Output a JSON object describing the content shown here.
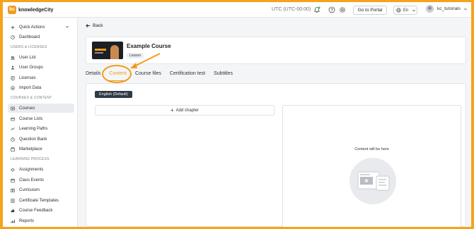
{
  "brand": {
    "name": "knowledgeCity",
    "mark": "kc",
    "color": "#f39a1b"
  },
  "topbar": {
    "timezone": "UTC (UTC-00:00)",
    "portal_button": "Go to Portal",
    "language": "En",
    "username": "kc_tutorials",
    "icons": [
      "bell-icon",
      "help-icon",
      "gear-icon",
      "globe-icon",
      "chevron-down-icon"
    ]
  },
  "sidebar": {
    "quick_actions": "Quick Actions",
    "dashboard": "Dashboard",
    "sections": [
      {
        "title": "USERS & LICENSES",
        "items": [
          "User List",
          "User Groups",
          "Licenses",
          "Import Data"
        ]
      },
      {
        "title": "COURSES & CONTENT",
        "items": [
          "Courses",
          "Course Lists",
          "Learning Paths",
          "Question Bank",
          "Marketplace"
        ]
      },
      {
        "title": "LEARNING PROCESS",
        "items": [
          "Assignments",
          "Class Events",
          "Curriculum",
          "Certificate Templates",
          "Course Feedback",
          "Reports"
        ]
      }
    ],
    "active_item": "Courses"
  },
  "main": {
    "back_label": "Back",
    "course": {
      "title": "Example Course",
      "badge": "Lesson"
    },
    "tabs": [
      "Details",
      "Content",
      "Course files",
      "Certification test",
      "Subtitles"
    ],
    "active_tab": "Content",
    "language_chip": "English (Default)",
    "add_chapter": "Add chapter",
    "preview_text": "Content will be here"
  },
  "colors": {
    "accent": "#f39a1b",
    "dark_chip": "#2f3a45",
    "page_bg": "#f4f5f7"
  }
}
